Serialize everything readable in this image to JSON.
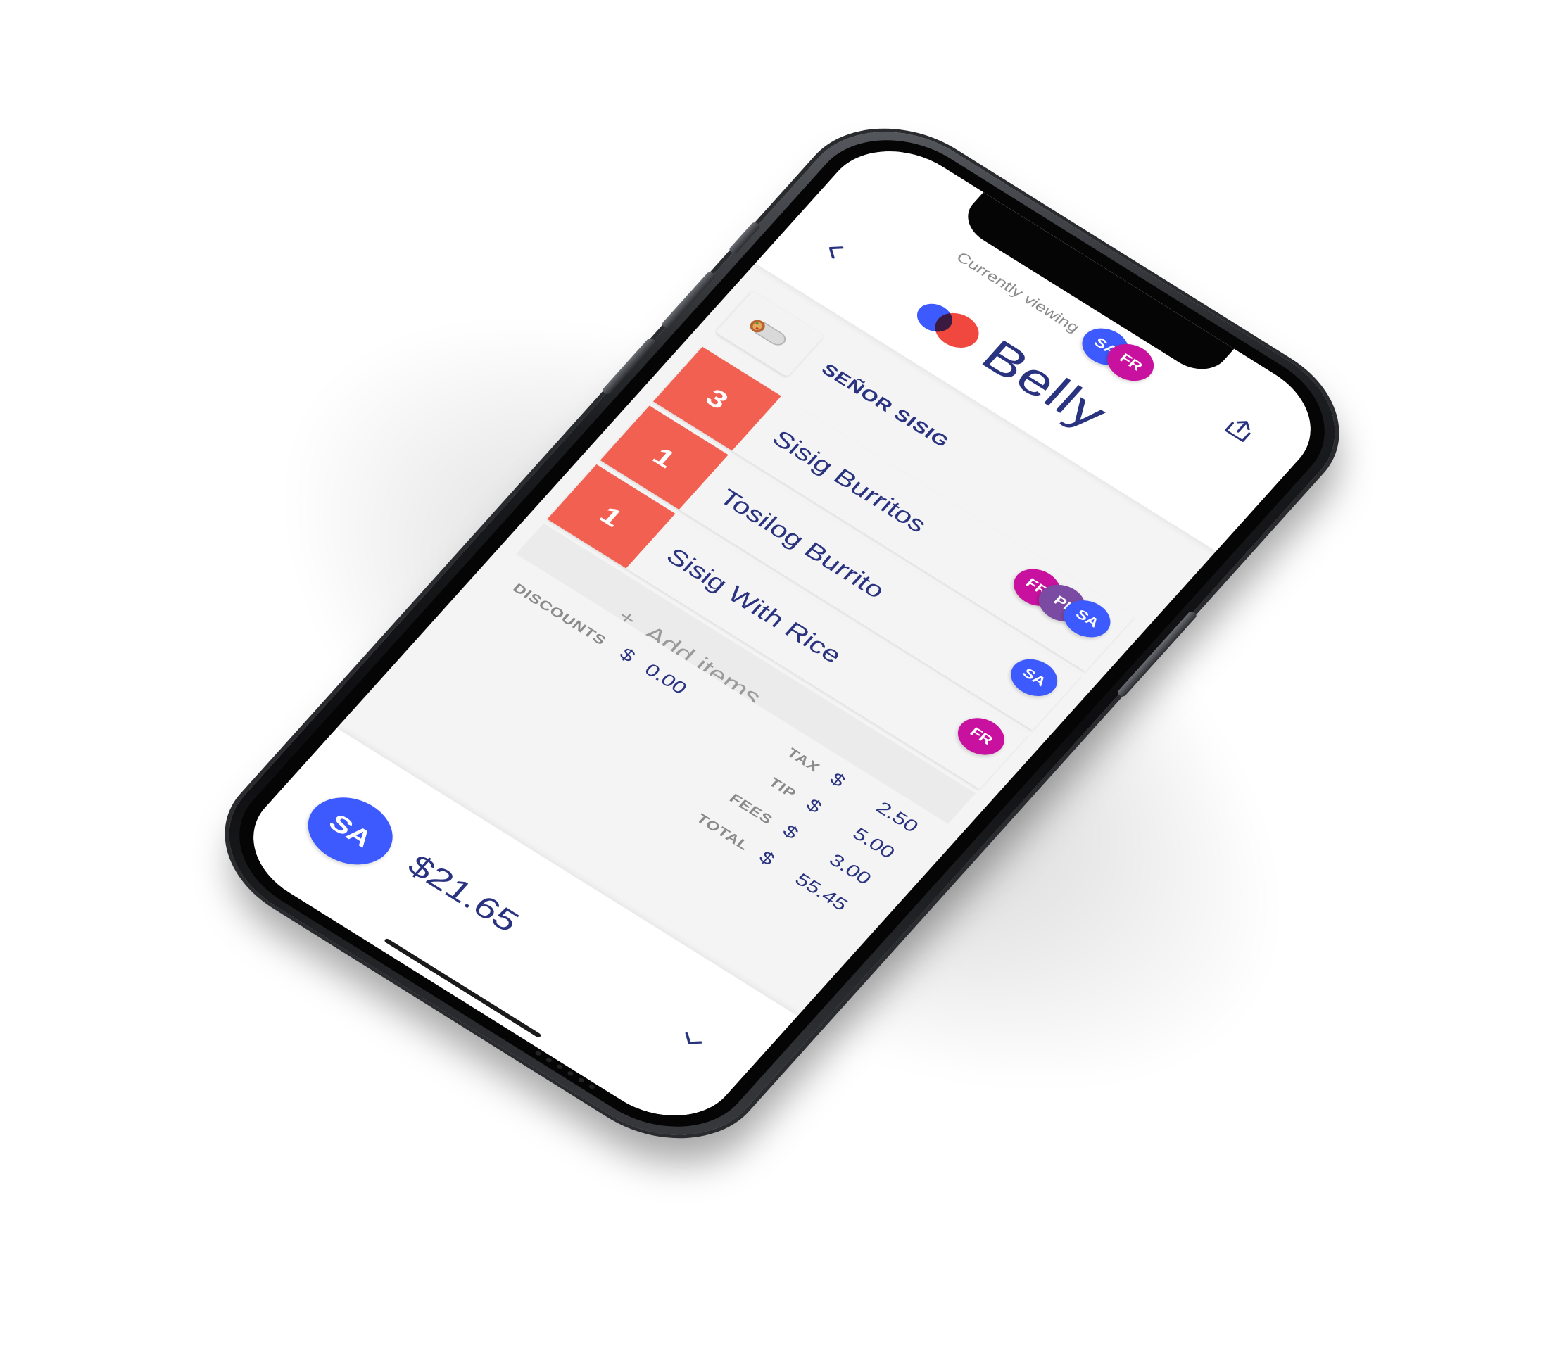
{
  "header": {
    "viewing_label": "Currently viewing",
    "viewers": [
      {
        "initials": "SA",
        "color": "#3d5afe"
      },
      {
        "initials": "FR",
        "color": "#c9119f"
      }
    ],
    "share_icon": "share-icon",
    "back_icon": "chevron-left-icon"
  },
  "brand": {
    "name": "Belly",
    "mark_colors": [
      "#3d5afe",
      "#f0483e"
    ]
  },
  "restaurant": {
    "name": "SEÑOR SISIG",
    "thumbnail_icon": "burrito-icon"
  },
  "items": [
    {
      "qty": "3",
      "name": "Sisig Burritos",
      "avatars": [
        "FR",
        "PI",
        "SA"
      ]
    },
    {
      "qty": "1",
      "name": "Tosilog Burrito",
      "avatars": [
        "SA"
      ]
    },
    {
      "qty": "1",
      "name": "Sisig With Rice",
      "avatars": [
        "FR"
      ]
    }
  ],
  "add_items": {
    "plus": "+",
    "label": "Add items"
  },
  "discounts": {
    "label": "DISCOUNTS",
    "currency": "$",
    "value": "0.00"
  },
  "summary": [
    {
      "label": "TAX",
      "currency": "$",
      "value": "2.50"
    },
    {
      "label": "TIP",
      "currency": "$",
      "value": "5.00"
    },
    {
      "label": "FEES",
      "currency": "$",
      "value": "3.00"
    },
    {
      "label": "TOTAL",
      "currency": "$",
      "value": "55.45"
    }
  ],
  "footer": {
    "user_initials": "SA",
    "amount": "$21.65",
    "expand_icon": "chevron-down-icon"
  },
  "colors": {
    "accent_red": "#f26052",
    "navy": "#2a3380",
    "blue": "#3d5afe",
    "magenta": "#c9119f",
    "purple": "#7b4aa3"
  }
}
